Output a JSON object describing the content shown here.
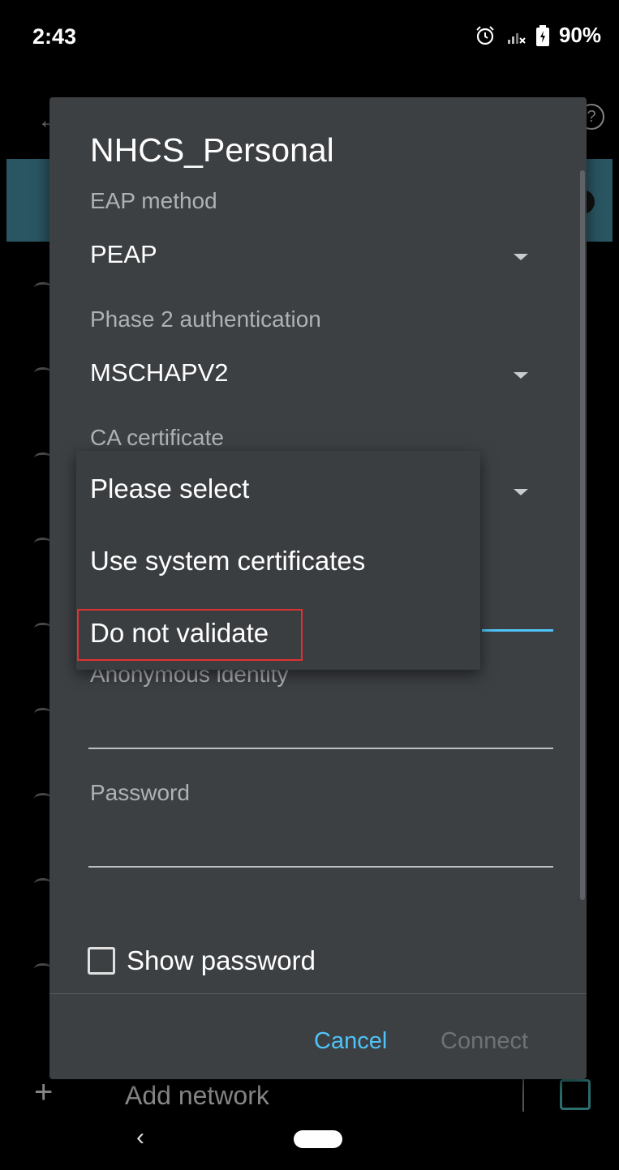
{
  "status_bar": {
    "time": "2:43",
    "battery": "90%"
  },
  "background": {
    "add_network_label": "Add network"
  },
  "dialog": {
    "title": "NHCS_Personal",
    "eap_method_label": "EAP method",
    "eap_method_value": "PEAP",
    "phase2_label": "Phase 2 authentication",
    "phase2_value": "MSCHAPV2",
    "ca_certificate_label": "CA certificate",
    "anonymous_identity_label": "Anonymous identity",
    "anonymous_identity_value": "",
    "password_label": "Password",
    "password_value": "",
    "show_password_label": "Show password",
    "show_password_checked": false,
    "cancel_label": "Cancel",
    "connect_label": "Connect"
  },
  "ca_menu": {
    "options": [
      "Please select",
      "Use system certificates",
      "Do not validate"
    ],
    "highlighted": "Do not validate"
  },
  "colors": {
    "accent": "#4fc3f7",
    "dialog_bg": "#3d4043",
    "highlight": "#e03131"
  }
}
